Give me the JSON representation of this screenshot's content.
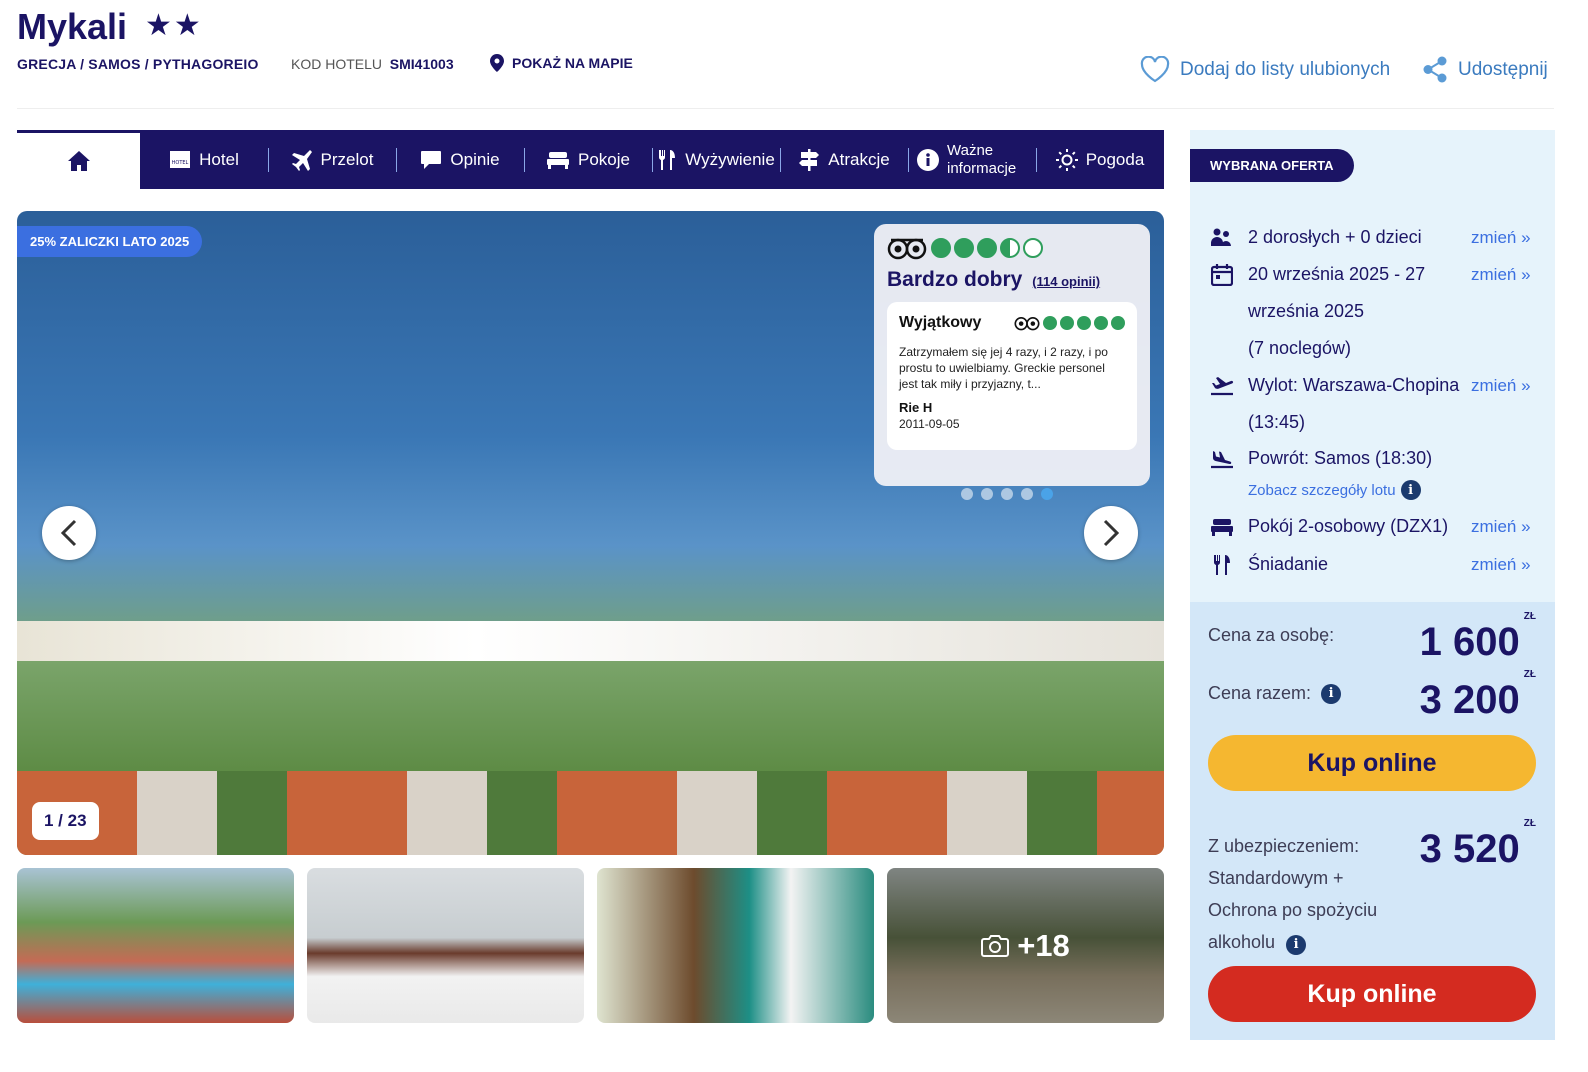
{
  "header": {
    "hotel_name": "Mykali",
    "stars": "★★",
    "breadcrumb": "GRECJA / SAMOS / PYTHAGOREIO",
    "code_label": "KOD HOTELU",
    "code_value": "SMI41003",
    "map_link": "POKAŻ NA MAPIE",
    "favorite": "Dodaj do listy ulubionych",
    "share": "Udostępnij"
  },
  "nav": {
    "items": [
      {
        "label": "Hotel",
        "icon": "hotel-icon"
      },
      {
        "label": "Przelot",
        "icon": "plane-icon"
      },
      {
        "label": "Opinie",
        "icon": "speech-bubble-icon"
      },
      {
        "label": "Pokoje",
        "icon": "bed-icon"
      },
      {
        "label": "Wyżywienie",
        "icon": "fork-knife-icon"
      },
      {
        "label": "Atrakcje",
        "icon": "signpost-icon"
      },
      {
        "label": "Ważne informacje",
        "icon": "info-icon"
      },
      {
        "label": "Pogoda",
        "icon": "sun-icon"
      }
    ]
  },
  "gallery": {
    "deposit_badge": "25% ZALICZKI LATO 2025",
    "counter": "1 / 23",
    "more_photos": "+18",
    "active_dot_index": 4,
    "dot_count": 5
  },
  "rating": {
    "score": 3.5,
    "max": 5,
    "label": "Bardzo dobry",
    "reviews_link": "(114 opinii)",
    "review": {
      "title": "Wyjątkowy",
      "score": 5,
      "text": "Zatrzymałem się jej 4 razy, i 2 razy, i po prostu to uwielbiamy. Greckie personel jest tak miły i przyjazny, t...",
      "author": "Rie H",
      "date": "2011-09-05"
    }
  },
  "offer": {
    "badge": "WYBRANA OFERTA",
    "change_label": "zmień »",
    "travelers": "2 dorosłych + 0 dzieci",
    "dates": "20 września 2025 - 27 września 2025",
    "nights": "(7 noclegów)",
    "departure": "Wylot: Warszawa-Chopina (13:45)",
    "return": "Powrót: Samos (18:30)",
    "flight_details": "Zobacz szczegóły lotu",
    "room": "Pokój 2-osobowy (DZX1)",
    "board": "Śniadanie"
  },
  "price": {
    "per_person_label": "Cena za osobę:",
    "per_person": "1 600",
    "total_label": "Cena razem:",
    "total": "3 200",
    "currency": "ZŁ",
    "buy_label": "Kup online",
    "insurance_label": "Z ubezpieczeniem: Standardowym + Ochrona po spożyciu alkoholu",
    "insurance_total": "3 520"
  },
  "colors": {
    "navy": "#1b1464",
    "accent": "#3b6fe0",
    "yellow": "#f5b730",
    "red": "#d42b20",
    "tripadvisor_green": "#2f9e5c"
  }
}
